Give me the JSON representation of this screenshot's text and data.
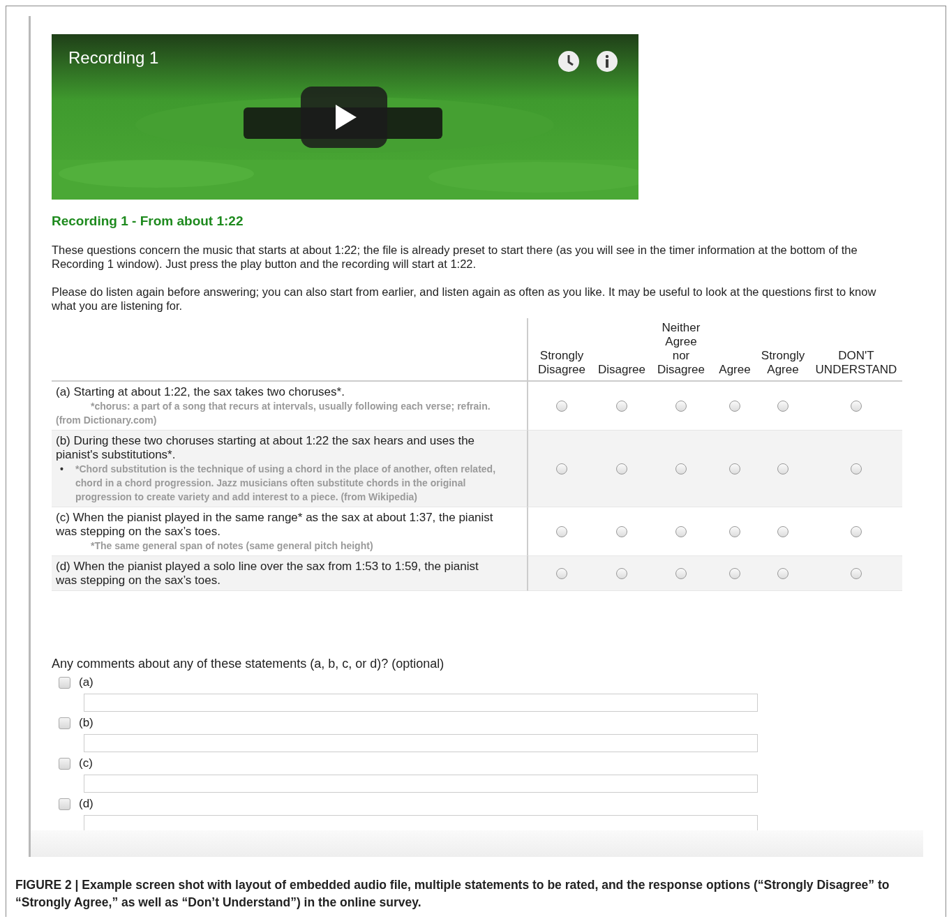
{
  "video": {
    "title": "Recording 1"
  },
  "section_title": "Recording 1 - From about 1:22",
  "intro": [
    "These questions concern the music that starts at about 1:22; the file is already preset to start there (as you will see in the timer information at the bottom of the Recording 1 window). Just press the play button and the recording will start at 1:22.",
    "Please do listen again before answering; you can also start from earlier, and listen again as often as you like. It may be useful to look at the questions first to know what you are listening for."
  ],
  "columns": [
    [
      "Strongly",
      "Disagree"
    ],
    [
      "Disagree"
    ],
    [
      "Neither",
      "Agree",
      "nor",
      "Disagree"
    ],
    [
      "Agree"
    ],
    [
      "Strongly",
      "Agree"
    ],
    [
      "DON'T",
      "UNDERSTAND"
    ]
  ],
  "statements": [
    {
      "text": "(a) Starting at about 1:22, the sax takes two choruses*.",
      "note": "*chorus: a part of a song that recurs at intervals, usually following each verse; refrain. (from Dictionary.com)",
      "ratings": [
        {
          "selected": false
        },
        {
          "selected": false
        },
        {
          "selected": false
        },
        {
          "selected": false
        },
        {
          "selected": false
        },
        {
          "selected": false
        }
      ]
    },
    {
      "text": "(b) During these two choruses starting at about 1:22 the sax hears and uses the pianist's substitutions*.",
      "note": "*Chord substitution is the technique of using a chord in the place of another, often related, chord in a chord progression. Jazz musicians often substitute chords in the original progression to create variety and add interest to a piece. (from Wikipedia)",
      "bullet": "•",
      "ratings": [
        {
          "selected": false
        },
        {
          "selected": false
        },
        {
          "selected": false
        },
        {
          "selected": false
        },
        {
          "selected": false
        },
        {
          "selected": false
        }
      ]
    },
    {
      "text": "(c) When the pianist played in the same range* as the sax at about 1:37, the pianist was stepping on the sax’s toes.",
      "note": "*The same general span of notes (same general pitch height)",
      "ratings": [
        {
          "selected": false
        },
        {
          "selected": false
        },
        {
          "selected": false
        },
        {
          "selected": false
        },
        {
          "selected": false
        },
        {
          "selected": false
        }
      ]
    },
    {
      "text": "(d) When the pianist played a solo line over the sax from 1:53 to 1:59, the pianist was stepping on the sax’s toes.",
      "ratings": [
        {
          "selected": false
        },
        {
          "selected": false
        },
        {
          "selected": false
        },
        {
          "selected": false
        },
        {
          "selected": false
        },
        {
          "selected": false
        }
      ]
    }
  ],
  "comments": {
    "question": "Any comments about any of these statements (a, b, c, or d)? (optional)",
    "items": [
      {
        "label": "(a)",
        "checked": false
      },
      {
        "label": "(b)",
        "checked": false
      },
      {
        "label": "(c)",
        "checked": false
      },
      {
        "label": "(d)",
        "checked": false
      }
    ]
  },
  "caption": "FIGURE 2 | Example screen shot with layout of embedded audio file, multiple statements to be rated, and the response options (“Strongly Disagree” to “Strongly Agree,” as well as “Don’t Understand”) in the online survey."
}
